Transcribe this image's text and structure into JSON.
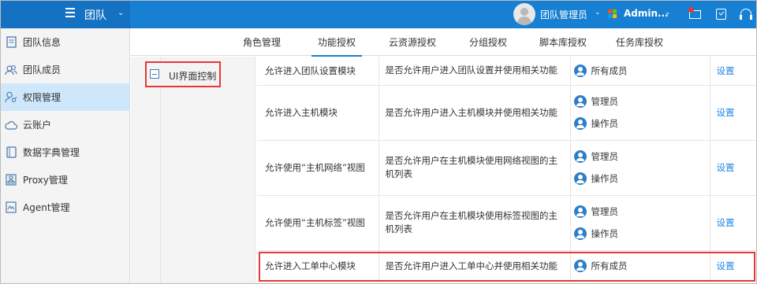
{
  "header": {
    "section_title": "团队",
    "user_name": "团队管理员",
    "admin_name": "Admin...",
    "caret": "⌄"
  },
  "sidebar": {
    "items": [
      {
        "label": "团队信息",
        "icon": "document-icon",
        "active": false
      },
      {
        "label": "团队成员",
        "icon": "users-icon",
        "active": false
      },
      {
        "label": "权限管理",
        "icon": "user-key-icon",
        "active": true
      },
      {
        "label": "云账户",
        "icon": "cloud-icon",
        "active": false
      },
      {
        "label": "数据字典管理",
        "icon": "book-icon",
        "active": false
      },
      {
        "label": "Proxy管理",
        "icon": "network-icon",
        "active": false
      },
      {
        "label": "Agent管理",
        "icon": "agent-icon",
        "active": false
      }
    ]
  },
  "tabs": [
    {
      "label": "角色管理",
      "active": false
    },
    {
      "label": "功能授权",
      "active": true
    },
    {
      "label": "云资源授权",
      "active": false
    },
    {
      "label": "分组授权",
      "active": false
    },
    {
      "label": "脚本库授权",
      "active": false
    },
    {
      "label": "任务库授权",
      "active": false
    }
  ],
  "tree": {
    "node_label": "UI界面控制",
    "toggle_symbol": "−"
  },
  "permissions": [
    {
      "name": "允许进入团队设置模块",
      "desc": "是否允许用户进入团队设置并使用相关功能",
      "roles": [
        "所有成员"
      ],
      "action": "设置"
    },
    {
      "name": "允许进入主机模块",
      "desc": "是否允许用户进入主机模块并使用相关功能",
      "roles": [
        "管理员",
        "操作员"
      ],
      "action": "设置"
    },
    {
      "name": "允许使用“主机网络”视图",
      "desc": "是否允许用户在主机模块使用网络视图的主机列表",
      "roles": [
        "管理员",
        "操作员"
      ],
      "action": "设置"
    },
    {
      "name": "允许使用“主机标签”视图",
      "desc": "是否允许用户在主机模块使用标签视图的主机列表",
      "roles": [
        "管理员",
        "操作员"
      ],
      "action": "设置"
    },
    {
      "name": "允许进入工单中心模块",
      "desc": "是否允许用户进入工单中心并使用相关功能",
      "roles": [
        "所有成员"
      ],
      "action": "设置"
    }
  ],
  "colors": {
    "header_bg": "#1780d2",
    "accent": "#1e88e5",
    "highlight": "#e53935",
    "active_nav": "#cfe7fa"
  }
}
